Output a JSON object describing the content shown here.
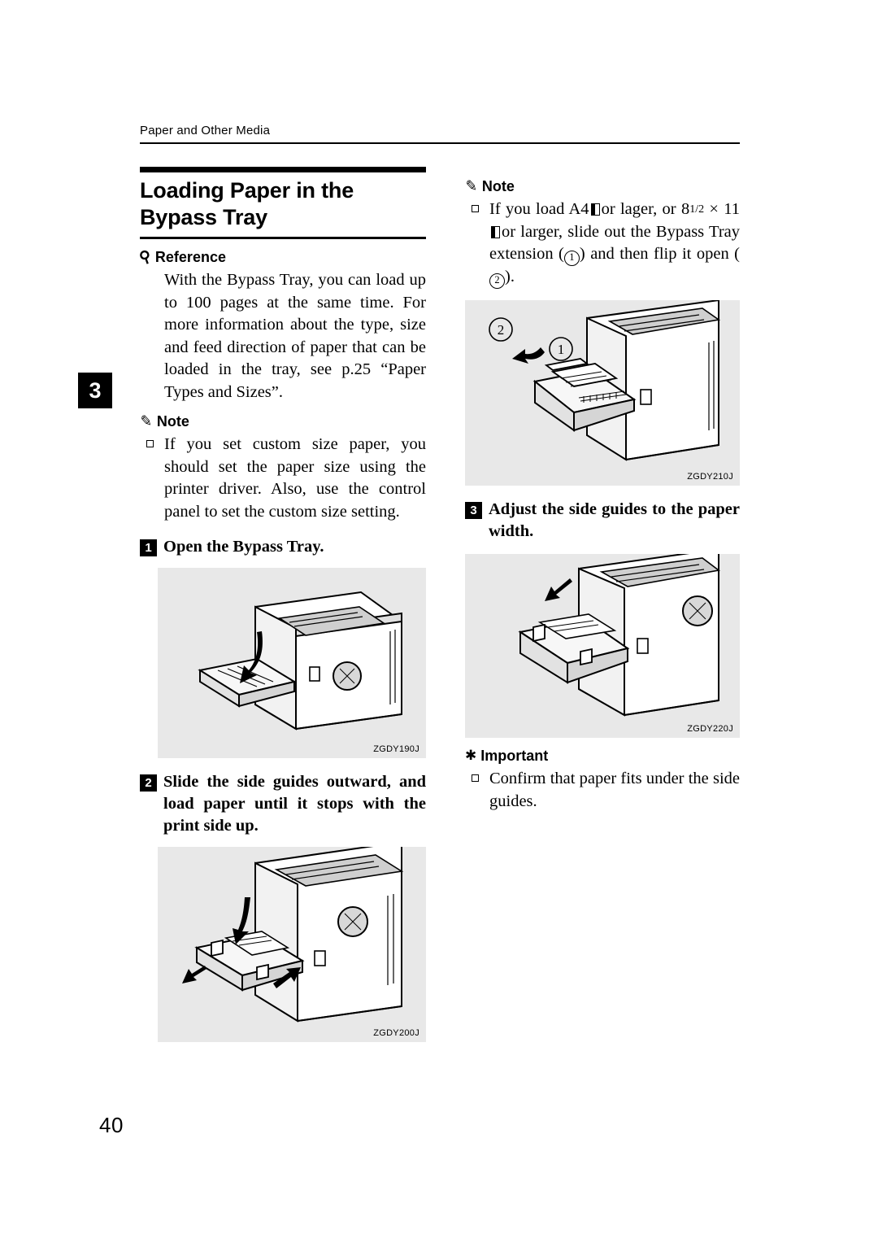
{
  "header": {
    "running_head": "Paper and Other Media"
  },
  "chapter_tab": "3",
  "page_number": "40",
  "left_column": {
    "title": "Loading Paper in the Bypass Tray",
    "reference_label": "Reference",
    "reference_icon": "magnifier-icon",
    "reference_text": "With the Bypass Tray, you can load up to 100 pages at the same time. For more information about the type, size and feed direction of paper that can be loaded in the tray, see p.25 “Paper Types and Sizes”.",
    "note_label": "Note",
    "note_icon": "pencil-note-icon",
    "note_text": "If you set custom size paper, you should set the paper size using the printer driver. Also, use the control panel to set the custom size setting.",
    "step1": {
      "number": "1",
      "text": "Open the Bypass Tray."
    },
    "figure1_code": "ZGDY190J",
    "step2": {
      "number": "2",
      "text": "Slide the side guides outward, and load paper until it stops with the print side up."
    },
    "figure2_code": "ZGDY200J"
  },
  "right_column": {
    "note_label": "Note",
    "note_icon": "pencil-note-icon",
    "note_text_part1": "If you load A4",
    "note_text_part2": "or lager, or",
    "note_text_line2_a": "8",
    "note_text_line2_frac": "1/2",
    "note_text_line2_b": "× 11",
    "note_text_line2_c": "or larger, slide out",
    "note_text_line3": "the Bypass Tray extension (",
    "note_circ1": "1",
    "note_text_line3_b": ")",
    "note_text_line4": "and then flip it open (",
    "note_circ2": "2",
    "note_text_line4_b": ").",
    "figure3_code": "ZGDY210J",
    "figure3_callout1": "1",
    "figure3_callout2": "2",
    "step3": {
      "number": "3",
      "text": "Adjust the side guides to the paper width."
    },
    "figure4_code": "ZGDY220J",
    "important_label": "Important",
    "important_icon": "exclamation-burst-icon",
    "important_text": "Confirm that paper fits under the side guides."
  }
}
